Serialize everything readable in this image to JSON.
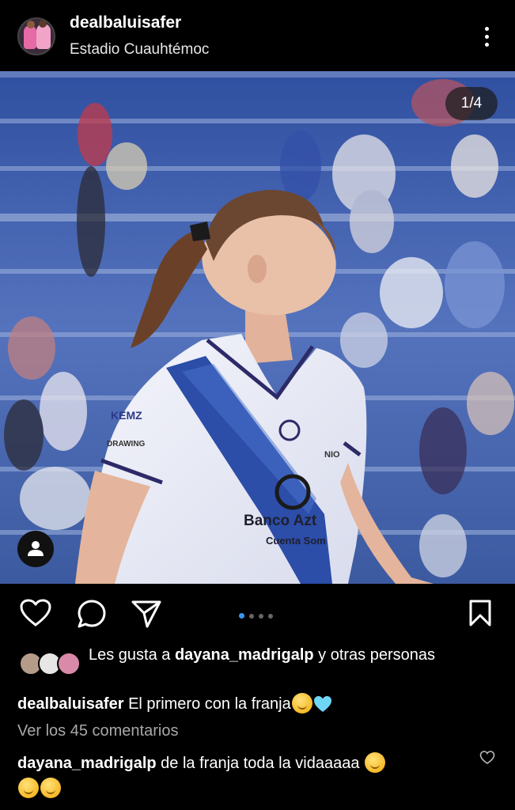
{
  "post": {
    "username": "dealbaluisafer",
    "location": "Estadio Cuauhtémoc",
    "counter": "1/4"
  },
  "icons": {
    "more": "more-vertical-icon",
    "like": "heart-icon",
    "comment": "comment-icon",
    "share": "send-icon",
    "save": "bookmark-icon",
    "tag": "user-tag-icon"
  },
  "carousel": {
    "total": 4,
    "active": 1
  },
  "likes": {
    "prefix": "Les gusta a ",
    "user": "dayana_madrigalp",
    "suffix": " y otras personas"
  },
  "caption": {
    "user": "dealbaluisafer",
    "text": " El primero con la franja"
  },
  "view_comments": "Ver los 45 comentarios",
  "comment": {
    "user": "dayana_madrigalp",
    "text": " de la franja toda la vidaaaaa "
  },
  "colors": {
    "background": "#000000",
    "accent": "#3897f0",
    "muted_text": "#a8a8a8",
    "heart_emoji": "#6fd6f5"
  }
}
